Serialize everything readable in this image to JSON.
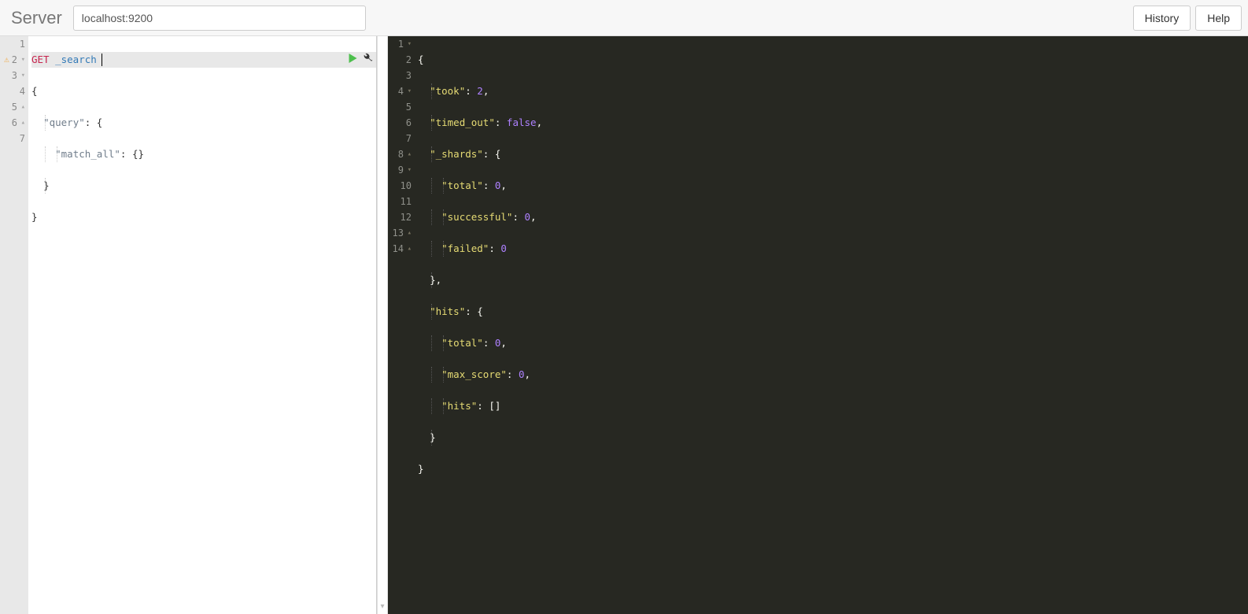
{
  "header": {
    "server_label": "Server",
    "server_value": "localhost:9200",
    "history_label": "History",
    "help_label": "Help"
  },
  "request": {
    "method": "GET",
    "path": "_search",
    "gutter": {
      "1": "1",
      "2": "2",
      "3": "3",
      "4": "4",
      "5": "5",
      "6": "6",
      "7": "7"
    },
    "body": {
      "l2": "{",
      "l3_key": "\"query\"",
      "l3_rest": ": {",
      "l4_key": "\"match_all\"",
      "l4_rest": ": {}",
      "l5": "}",
      "l6": "}"
    }
  },
  "response": {
    "gutter": {
      "1": "1",
      "2": "2",
      "3": "3",
      "4": "4",
      "5": "5",
      "6": "6",
      "7": "7",
      "8": "8",
      "9": "9",
      "10": "10",
      "11": "11",
      "12": "12",
      "13": "13",
      "14": "14"
    },
    "lines": {
      "l1_open": "{",
      "l2_k": "\"took\"",
      "l2_v": "2",
      "l3_k": "\"timed_out\"",
      "l3_v": "false",
      "l4_k": "\"_shards\"",
      "l5_k": "\"total\"",
      "l5_v": "0",
      "l6_k": "\"successful\"",
      "l6_v": "0",
      "l7_k": "\"failed\"",
      "l7_v": "0",
      "l8_close": "},",
      "l9_k": "\"hits\"",
      "l10_k": "\"total\"",
      "l10_v": "0",
      "l11_k": "\"max_score\"",
      "l11_v": "0",
      "l12_k": "\"hits\"",
      "l12_v": "[]",
      "l13_close": "}",
      "l14_close": "}"
    }
  }
}
